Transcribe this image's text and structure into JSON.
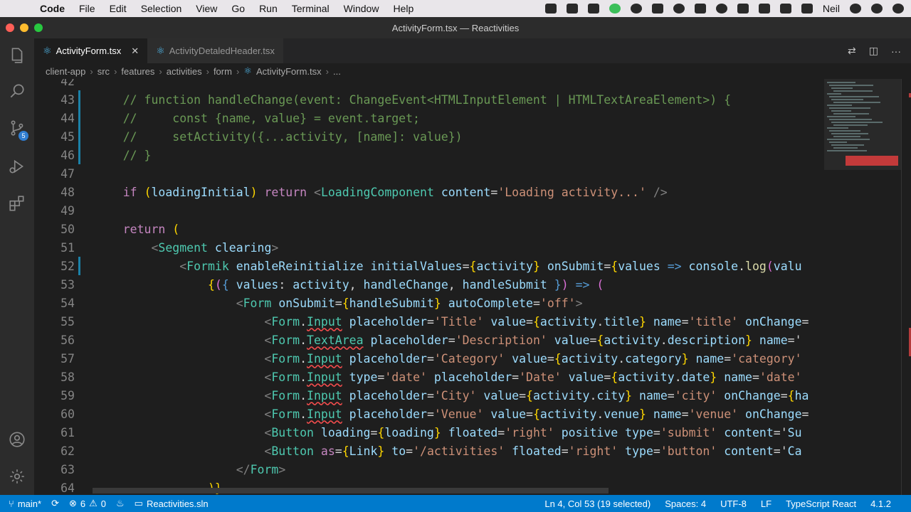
{
  "menubar": {
    "app": "Code",
    "items": [
      "File",
      "Edit",
      "Selection",
      "View",
      "Go",
      "Run",
      "Terminal",
      "Window",
      "Help"
    ],
    "user": "Neil"
  },
  "window": {
    "title": "ActivityForm.tsx — Reactivities"
  },
  "activity_bar": {
    "scm_badge": "5"
  },
  "tabs": [
    {
      "label": "ActivityForm.tsx",
      "active": true
    },
    {
      "label": "ActivityDetaledHeader.tsx",
      "active": false
    }
  ],
  "breadcrumb": [
    "client-app",
    "src",
    "features",
    "activities",
    "form",
    "ActivityForm.tsx",
    "..."
  ],
  "editor": {
    "lines": [
      {
        "n": "42",
        "text": ""
      },
      {
        "n": "43",
        "text": "    // function handleChange(event: ChangeEvent<HTMLInputElement | HTMLTextAreaElement>) {"
      },
      {
        "n": "44",
        "text": "    //     const {name, value} = event.target;"
      },
      {
        "n": "45",
        "text": "    //     setActivity({...activity, [name]: value})"
      },
      {
        "n": "46",
        "text": "    // }"
      },
      {
        "n": "47",
        "text": ""
      },
      {
        "n": "48",
        "text": "    if (loadingInitial) return <LoadingComponent content='Loading activity...' />"
      },
      {
        "n": "49",
        "text": ""
      },
      {
        "n": "50",
        "text": "    return ("
      },
      {
        "n": "51",
        "text": "        <Segment clearing>"
      },
      {
        "n": "52",
        "text": "            <Formik enableReinitialize initialValues={activity} onSubmit={values => console.log(valu"
      },
      {
        "n": "53",
        "text": "                {({ values: activity, handleChange, handleSubmit }) => ("
      },
      {
        "n": "54",
        "text": "                    <Form onSubmit={handleSubmit} autoComplete='off'>"
      },
      {
        "n": "55",
        "text": "                        <Form.Input placeholder='Title' value={activity.title} name='title' onChange="
      },
      {
        "n": "56",
        "text": "                        <Form.TextArea placeholder='Description' value={activity.description} name='"
      },
      {
        "n": "57",
        "text": "                        <Form.Input placeholder='Category' value={activity.category} name='category'"
      },
      {
        "n": "58",
        "text": "                        <Form.Input type='date' placeholder='Date' value={activity.date} name='date'"
      },
      {
        "n": "59",
        "text": "                        <Form.Input placeholder='City' value={activity.city} name='city' onChange={ha"
      },
      {
        "n": "60",
        "text": "                        <Form.Input placeholder='Venue' value={activity.venue} name='venue' onChange="
      },
      {
        "n": "61",
        "text": "                        <Button loading={loading} floated='right' positive type='submit' content='Su"
      },
      {
        "n": "62",
        "text": "                        <Button as={Link} to='/activities' floated='right' type='button' content='Ca"
      },
      {
        "n": "63",
        "text": "                    </Form>"
      },
      {
        "n": "64",
        "text": "                )}"
      }
    ]
  },
  "statusbar": {
    "branch": "main*",
    "errors": "6",
    "warnings": "0",
    "solution": "Reactivities.sln",
    "cursor": "Ln 4, Col 53 (19 selected)",
    "spaces": "Spaces: 4",
    "encoding": "UTF-8",
    "eol": "LF",
    "language": "TypeScript React",
    "version": "4.1.2"
  },
  "colors": {
    "statusbar": "#007acc",
    "editor_bg": "#1e1e1e",
    "comment": "#6a9955",
    "keyword": "#c586c0",
    "string": "#ce9178",
    "tag": "#4ec9b0"
  }
}
